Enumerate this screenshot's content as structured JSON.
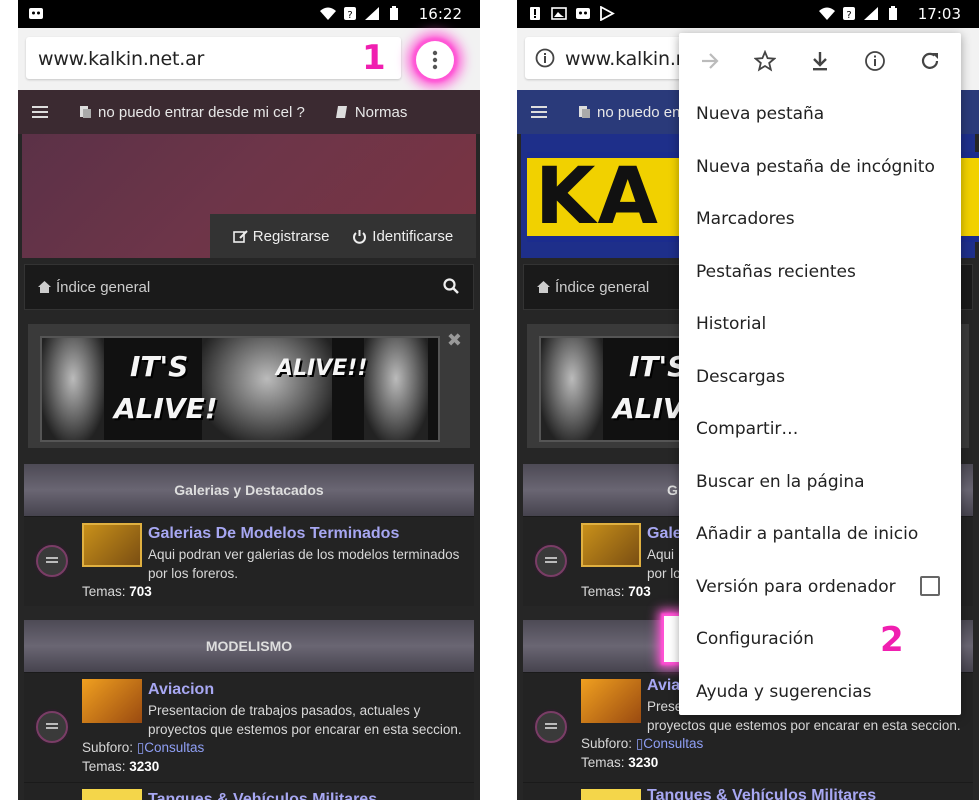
{
  "left": {
    "status": {
      "time": "16:22"
    },
    "url": "www.kalkin.net.ar",
    "annotation": "1",
    "nav": {
      "item1": "no puedo entrar desde mi cel ?",
      "item2": "Normas"
    },
    "header": {
      "register": "Registrarse",
      "login": "Identificarse"
    },
    "breadcrumb": "Índice general",
    "banner": {
      "text1": "IT'S",
      "text2": "ALIVE!",
      "text3": "ALIVE!!"
    },
    "section1": {
      "title": "Galerias y Destacados",
      "forum": {
        "title": "Galerias De Modelos Terminados",
        "desc": "Aqui podran ver galerias de los modelos terminados por los foreros.",
        "temas_label": "Temas:",
        "temas": "703"
      }
    },
    "section2": {
      "title": "MODELISMO",
      "forum": {
        "title": "Aviacion",
        "desc": "Presentacion de trabajos pasados, actuales y proyectos que estemos por encarar en esta seccion.",
        "subforo_label": "Subforo:",
        "subforo": "Consultas",
        "temas_label": "Temas:",
        "temas": "3230"
      },
      "next_title": "Tanques & Vehículos Militares"
    }
  },
  "right": {
    "status": {
      "time": "17:03"
    },
    "url": "www.kalkin.ne",
    "nav_item1": "no puedo en",
    "logo": "KA",
    "breadcrumb": "Índice general",
    "section1": {
      "title_fragment": "G",
      "forum_title": "Gale",
      "desc1": "Aqui",
      "desc2": "por lo",
      "temas_label": "Temas:",
      "temas": "703"
    },
    "section2": {
      "forum_title": "Avia",
      "desc1": "Prese",
      "desc2": "proyectos que estemos por encarar en esta seccion.",
      "subforo_label": "Subforo:",
      "subforo": "Consultas",
      "temas_label": "Temas:",
      "temas": "3230",
      "next_title": "Tanques & Vehículos Militares"
    },
    "menu": {
      "items": [
        "Nueva pestaña",
        "Nueva pestaña de incógnito",
        "Marcadores",
        "Pestañas recientes",
        "Historial",
        "Descargas",
        "Compartir…",
        "Buscar en la página",
        "Añadir a pantalla de inicio",
        "Versión para ordenador",
        "Configuración",
        "Ayuda y sugerencias"
      ]
    },
    "annotation": "2"
  },
  "colors": {
    "highlight": "#ff2bc8",
    "forum_link": "#a7a7f2",
    "urlbar": "#f2f2f2"
  }
}
